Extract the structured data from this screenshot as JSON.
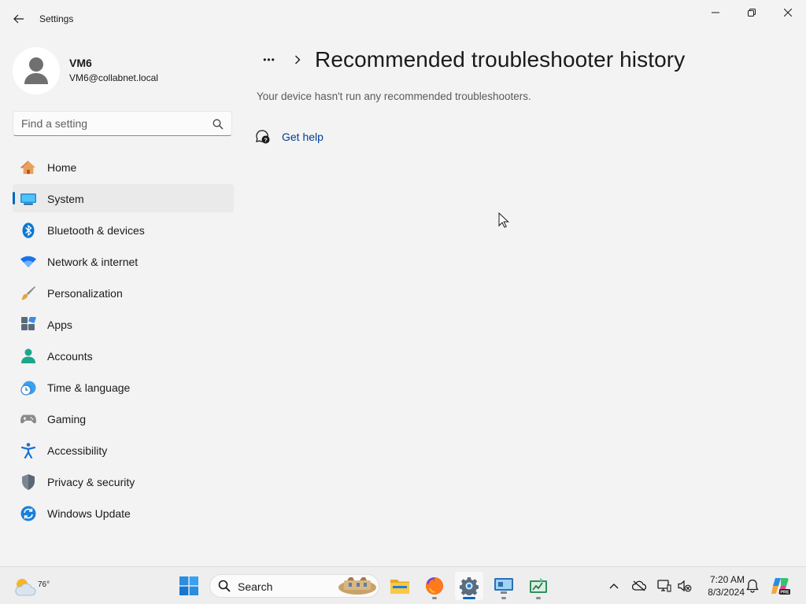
{
  "window": {
    "title": "Settings"
  },
  "profile": {
    "name": "VM6",
    "email": "VM6@collabnet.local"
  },
  "search": {
    "placeholder": "Find a setting"
  },
  "sidebar": {
    "items": [
      {
        "label": "Home",
        "icon": "home-icon"
      },
      {
        "label": "System",
        "icon": "system-icon",
        "active": true
      },
      {
        "label": "Bluetooth & devices",
        "icon": "bluetooth-icon"
      },
      {
        "label": "Network & internet",
        "icon": "wifi-icon"
      },
      {
        "label": "Personalization",
        "icon": "brush-icon"
      },
      {
        "label": "Apps",
        "icon": "apps-icon"
      },
      {
        "label": "Accounts",
        "icon": "accounts-icon"
      },
      {
        "label": "Time & language",
        "icon": "clock-globe-icon"
      },
      {
        "label": "Gaming",
        "icon": "gamepad-icon"
      },
      {
        "label": "Accessibility",
        "icon": "accessibility-icon"
      },
      {
        "label": "Privacy & security",
        "icon": "shield-icon"
      },
      {
        "label": "Windows Update",
        "icon": "update-icon"
      }
    ]
  },
  "main": {
    "breadcrumb_more": "•••",
    "title": "Recommended troubleshooter history",
    "empty_message": "Your device hasn't run any recommended troubleshooters.",
    "help_link": "Get help"
  },
  "taskbar": {
    "weather_temp": "76°",
    "search_label": "Search",
    "time": "7:20 AM",
    "date": "8/3/2024"
  },
  "colors": {
    "accent": "#0067c0",
    "link": "#003e92",
    "background": "#f3f3f3"
  }
}
